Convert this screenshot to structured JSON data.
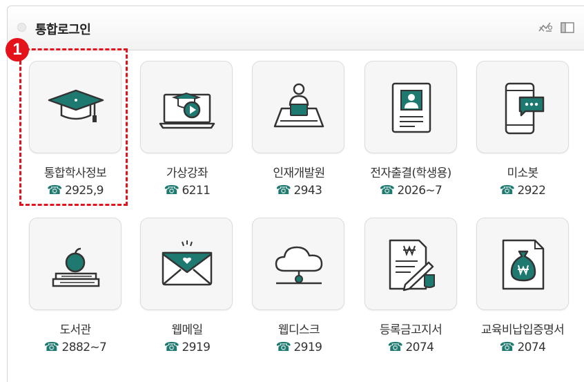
{
  "header": {
    "title": "통합로그인",
    "icons": [
      "edit-settings-icon",
      "window-icon"
    ]
  },
  "annotation": {
    "badge_number": "1"
  },
  "phone_icon": "☎",
  "colors": {
    "accent": "#1e7a70",
    "highlight": "#e3121b"
  },
  "services": [
    {
      "label": "통합학사정보",
      "phone": "2925,9",
      "icon": "graduation-cap-icon"
    },
    {
      "label": "가상강좌",
      "phone": "6211",
      "icon": "online-lecture-icon"
    },
    {
      "label": "인재개발원",
      "phone": "2943",
      "icon": "desk-person-icon"
    },
    {
      "label": "전자출결(학생용)",
      "phone": "2026~7",
      "icon": "id-card-icon"
    },
    {
      "label": "미소봇",
      "phone": "2922",
      "icon": "chatbot-phone-icon"
    },
    {
      "label": "도서관",
      "phone": "2882~7",
      "icon": "books-apple-icon"
    },
    {
      "label": "웹메일",
      "phone": "2919",
      "icon": "mail-icon"
    },
    {
      "label": "웹디스크",
      "phone": "2919",
      "icon": "cloud-disk-icon"
    },
    {
      "label": "등록금고지서",
      "phone": "2074",
      "icon": "tuition-bill-icon"
    },
    {
      "label": "교육비납입증명서",
      "phone": "2074",
      "icon": "payment-certificate-icon"
    }
  ]
}
